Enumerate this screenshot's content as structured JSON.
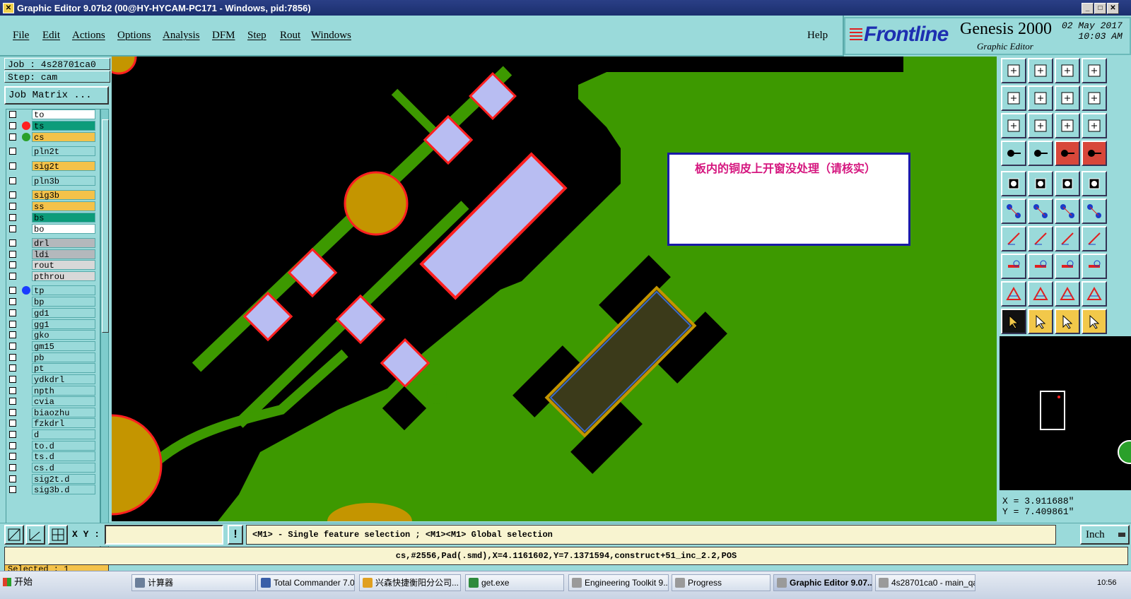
{
  "window": {
    "title": "Graphic Editor 9.07b2 (00@HY-HYCAM-PC171 - Windows, pid:7856)"
  },
  "menu": {
    "items": [
      "File",
      "Edit",
      "Actions",
      "Options",
      "Analysis",
      "DFM",
      "Step",
      "Rout",
      "Windows"
    ],
    "help": "Help"
  },
  "brand": {
    "logo_text": "Frontline",
    "product": "Genesis 2000",
    "subtitle": "Graphic Editor",
    "date": "02 May 2017",
    "time": "10:03 AM"
  },
  "left": {
    "job": "Job : 4s28701ca0",
    "step": "Step: cam",
    "job_matrix": "Job Matrix ...",
    "selected": "Selected : 1",
    "layers": [
      {
        "name": "to",
        "color": "#ffffff",
        "dot": ""
      },
      {
        "name": "ts",
        "color": "#0c9c7a",
        "dot": "#ff2020"
      },
      {
        "name": "cs",
        "color": "#f4c24a",
        "dot": "#2aa02a"
      },
      {
        "name": "pln2t",
        "color": "#9adada",
        "dot": ""
      },
      {
        "name": "sig2t",
        "color": "#f4c24a",
        "dot": ""
      },
      {
        "name": "pln3b",
        "color": "#9adada",
        "dot": ""
      },
      {
        "name": "sig3b",
        "color": "#f4c24a",
        "dot": ""
      },
      {
        "name": "ss",
        "color": "#f4c24a",
        "dot": ""
      },
      {
        "name": "bs",
        "color": "#0c9c7a",
        "dot": ""
      },
      {
        "name": "bo",
        "color": "#ffffff",
        "dot": ""
      },
      {
        "name": "drl",
        "color": "#b4b8bc",
        "dot": ""
      },
      {
        "name": "ldi",
        "color": "#b4b8bc",
        "dot": ""
      },
      {
        "name": "rout",
        "color": "#d8d8d8",
        "dot": ""
      },
      {
        "name": "pthrou",
        "color": "#d8d8d8",
        "dot": ""
      },
      {
        "name": "tp",
        "color": "#9adada",
        "dot": "#1a3cff"
      },
      {
        "name": "bp",
        "color": "#9adada",
        "dot": ""
      },
      {
        "name": "gd1",
        "color": "#9adada",
        "dot": ""
      },
      {
        "name": "gg1",
        "color": "#9adada",
        "dot": ""
      },
      {
        "name": "gko",
        "color": "#9adada",
        "dot": ""
      },
      {
        "name": "gm15",
        "color": "#9adada",
        "dot": ""
      },
      {
        "name": "pb",
        "color": "#9adada",
        "dot": ""
      },
      {
        "name": "pt",
        "color": "#9adada",
        "dot": ""
      },
      {
        "name": "ydkdrl",
        "color": "#9adada",
        "dot": ""
      },
      {
        "name": "npth",
        "color": "#9adada",
        "dot": ""
      },
      {
        "name": "cvia",
        "color": "#9adada",
        "dot": ""
      },
      {
        "name": "biaozhu",
        "color": "#9adada",
        "dot": ""
      },
      {
        "name": "fzkdrl",
        "color": "#9adada",
        "dot": ""
      },
      {
        "name": "d",
        "color": "#9adada",
        "dot": ""
      },
      {
        "name": "to.d",
        "color": "#9adada",
        "dot": ""
      },
      {
        "name": "ts.d",
        "color": "#9adada",
        "dot": ""
      },
      {
        "name": "cs.d",
        "color": "#9adada",
        "dot": ""
      },
      {
        "name": "sig2t.d",
        "color": "#9adada",
        "dot": ""
      },
      {
        "name": "sig3b.d",
        "color": "#9adada",
        "dot": ""
      }
    ]
  },
  "canvas": {
    "note": "板内的铜皮上开窗没处理（请核实）"
  },
  "coords": {
    "x": "X =  3.911688\"",
    "y": "Y =  7.409861\""
  },
  "bottom": {
    "xy_label": "X Y :",
    "xy_value": "",
    "hint": "<M1> - Single feature selection ; <M1><M1> Global selection",
    "units": "Inch",
    "status": "cs,#2556,Pad(.smd),X=4.1161602,Y=7.1371594,construct+51_inc_2.2,POS"
  },
  "taskbar": {
    "start": "开始",
    "tasks": [
      {
        "label": "计算器",
        "color": "#6b7f9a"
      },
      {
        "label": "Total Commander 7.0 ...",
        "color": "#3a5fa8"
      },
      {
        "label": "兴森快捷衡阳分公司...",
        "color": "#e0a020"
      },
      {
        "label": "get.exe",
        "color": "#2e8a3c"
      },
      {
        "label": "Engineering Toolkit 9....",
        "color": "#9a9a9a"
      },
      {
        "label": "Progress",
        "color": "#9a9a9a"
      },
      {
        "label": "Graphic Editor 9.07...",
        "color": "#9a9a9a"
      },
      {
        "label": "4s28701ca0 - main_qa",
        "color": "#9a9a9a"
      }
    ],
    "clock": "10:56"
  }
}
